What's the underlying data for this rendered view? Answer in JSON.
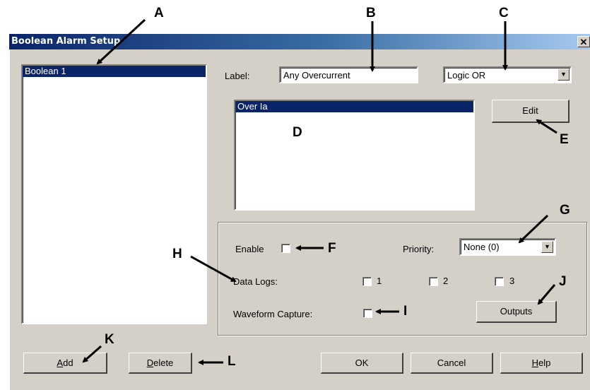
{
  "window": {
    "title": "Boolean Alarm Setup",
    "close_glyph": "✕"
  },
  "alarm_list": {
    "items": [
      "Boolean 1"
    ],
    "selected": "Boolean 1"
  },
  "label_field": {
    "label": "Label:",
    "value": "Any Overcurrent"
  },
  "logic_select": {
    "value": "Logic OR"
  },
  "conditions": {
    "items": [
      "Over Ia"
    ]
  },
  "edit_button": "Edit",
  "enable": {
    "label": "Enable",
    "checked": false
  },
  "priority": {
    "label": "Priority:",
    "value": "None (0)"
  },
  "data_logs": {
    "label": "Data Logs:",
    "options": [
      "1",
      "2",
      "3"
    ]
  },
  "waveform": {
    "label": "Waveform Capture:",
    "checked": false
  },
  "outputs_button": "Outputs",
  "buttons": {
    "add_prefix": "A",
    "add_rest": "dd",
    "delete_prefix": "D",
    "delete_rest": "elete",
    "ok": "OK",
    "cancel": "Cancel",
    "help_prefix": "H",
    "help_rest": "elp"
  },
  "callouts": [
    "A",
    "B",
    "C",
    "D",
    "E",
    "F",
    "G",
    "H",
    "I",
    "J",
    "K",
    "L"
  ],
  "colors": {
    "dialog_bg": "#d4d0c8",
    "title_dark": "#0a246a",
    "selection": "#0a246a"
  }
}
